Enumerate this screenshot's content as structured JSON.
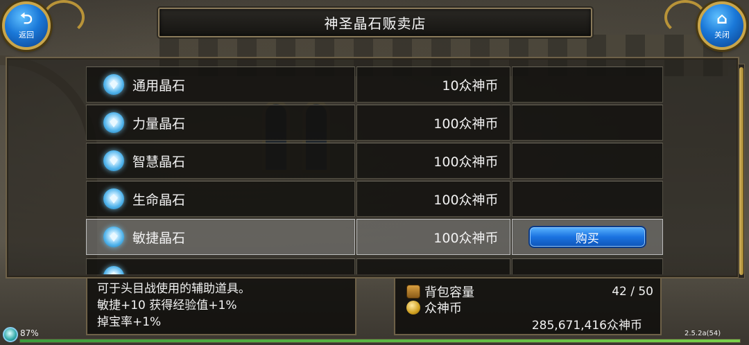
{
  "header": {
    "title": "神圣晶石贩卖店",
    "back_label": "返回",
    "close_label": "关闭",
    "back_icon": "return-arrow-icon",
    "close_icon": "home-icon"
  },
  "shop": {
    "items": [
      {
        "name": "通用晶石",
        "price": "10众神币",
        "icon": "blue-crystal-icon"
      },
      {
        "name": "力量晶石",
        "price": "100众神币",
        "icon": "blue-crystal-icon"
      },
      {
        "name": "智慧晶石",
        "price": "100众神币",
        "icon": "blue-crystal-icon"
      },
      {
        "name": "生命晶石",
        "price": "100众神币",
        "icon": "blue-crystal-icon"
      },
      {
        "name": "敏捷晶石",
        "price": "100众神币",
        "icon": "blue-crystal-icon",
        "selected": true
      }
    ],
    "buy_label": "购买"
  },
  "description": {
    "lines": [
      "可于头目战使用的辅助道具。",
      "敏捷+10 获得经验值+1%",
      "掉宝率+1%"
    ]
  },
  "inventory": {
    "bag_label": "背包容量",
    "bag_value": "42 / 50",
    "currency_label": "众神币",
    "currency_value": "285,671,416众神币",
    "bag_fill": 0.84
  },
  "status": {
    "battery": "87%",
    "version": "2.5.2a(54)"
  },
  "colors": {
    "accent_blue": "#1a72e0",
    "frame_gold": "#c9a64b"
  }
}
